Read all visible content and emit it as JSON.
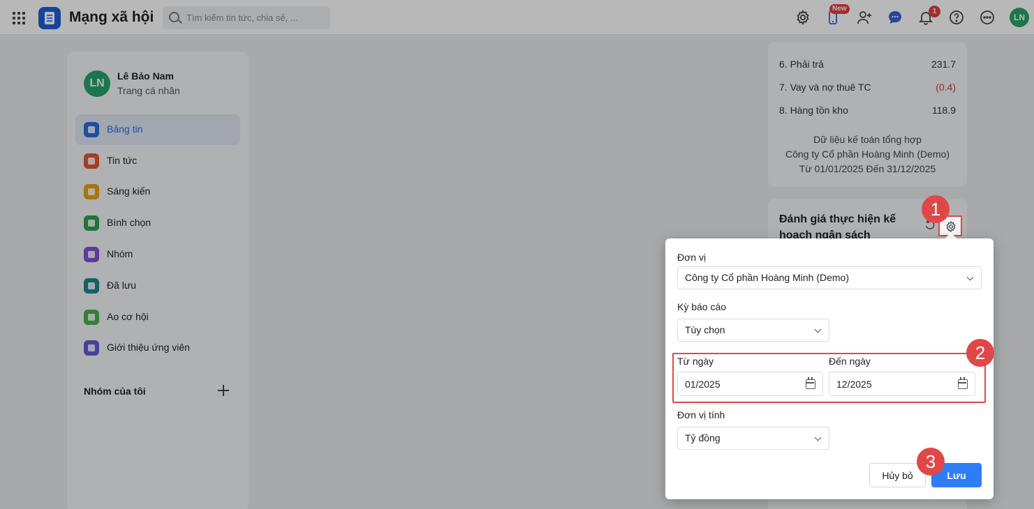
{
  "app": {
    "title": "Mạng xã hội"
  },
  "search": {
    "placeholder": "Tìm kiếm tin tức, chia sẻ, ..."
  },
  "topbar": {
    "new_badge": "New",
    "notification_count": "1",
    "avatar_initials": "LN"
  },
  "profile": {
    "initials": "LN",
    "name": "Lê Bảo Nam",
    "subtitle": "Trang cá nhân"
  },
  "sidebar": {
    "items": [
      {
        "label": "Bảng tin",
        "color": "#2b6de0"
      },
      {
        "label": "Tin tức",
        "color": "#e0583a"
      },
      {
        "label": "Sáng kiến",
        "color": "#e8a317"
      },
      {
        "label": "Bình chọn",
        "color": "#2f9e57"
      },
      {
        "label": "Nhóm",
        "color": "#7b55d6"
      },
      {
        "label": "Đã lưu",
        "color": "#1a8a8a"
      },
      {
        "label": "Ao cơ hội",
        "color": "#4caf50"
      },
      {
        "label": "Giới thiệu ứng viên",
        "color": "#5a5fd6"
      }
    ],
    "my_groups": "Nhóm của tôi"
  },
  "summary_card": {
    "rows": [
      {
        "label": "6. Phải trả",
        "value": "231.7"
      },
      {
        "label": "7. Vay và nợ thuê TC",
        "value": "(0.4)"
      },
      {
        "label": "8. Hàng tồn kho",
        "value": "118.9"
      }
    ],
    "footer": [
      "Dữ liệu kế toán tổng hợp",
      "Công ty Cổ phần Hoàng Minh (Demo)",
      "Từ 01/01/2025 Đến 31/12/2025"
    ]
  },
  "budget_card": {
    "title": "Đánh giá thực hiện kế hoạch ngân sách"
  },
  "modal": {
    "unit_label": "Đơn vị",
    "unit_value": "Công ty Cổ phần Hoàng Minh (Demo)",
    "period_label": "Kỳ báo cáo",
    "period_value": "Tùy chọn",
    "from_label": "Từ ngày",
    "from_value": "01/2025",
    "to_label": "Đến ngày",
    "to_value": "12/2025",
    "measure_label": "Đơn vị tính",
    "measure_value": "Tỷ đồng",
    "cancel_label": "Hủy bỏ",
    "save_label": "Lưu"
  },
  "callouts": [
    "1",
    "2",
    "3"
  ]
}
